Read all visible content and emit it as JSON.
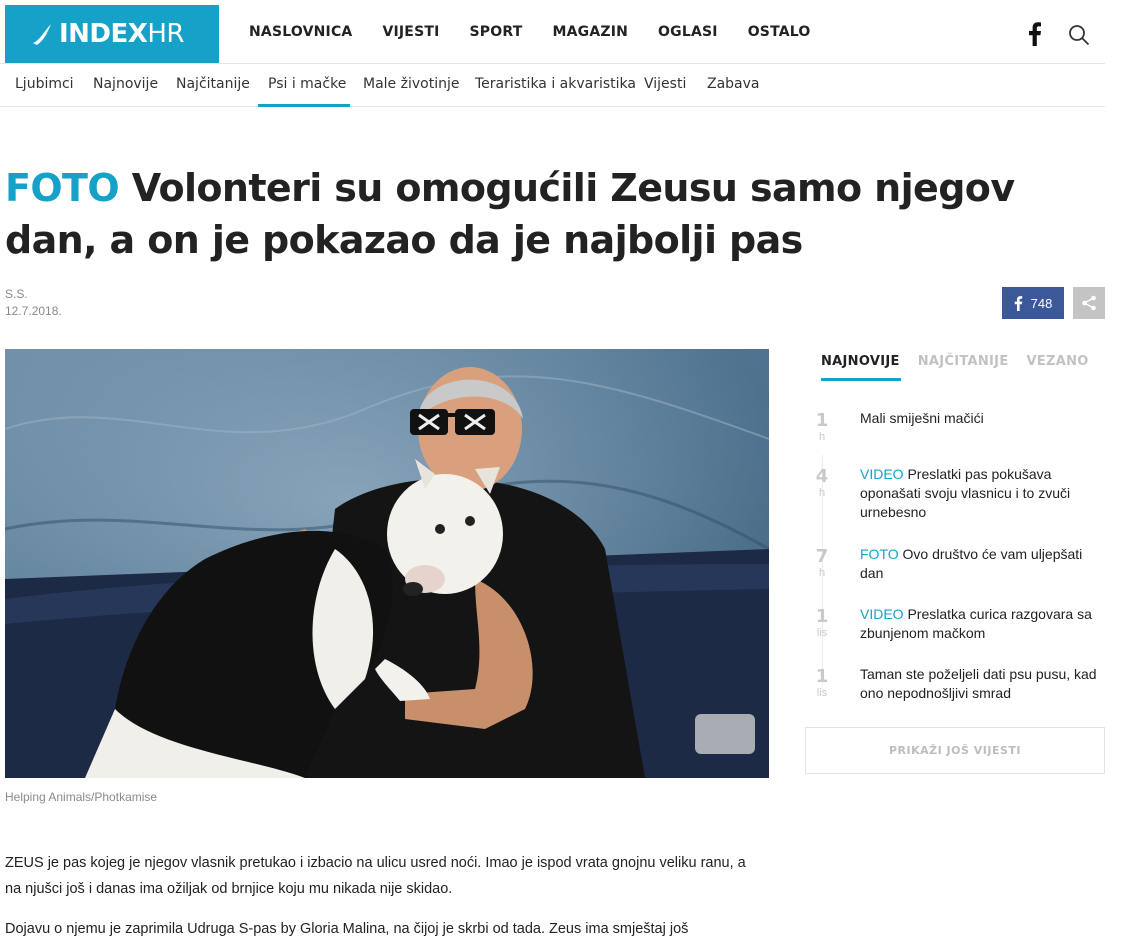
{
  "logo": {
    "brand": "INDEX",
    "suffix": "HR"
  },
  "main_nav": [
    "NASLOVNICA",
    "VIJESTI",
    "SPORT",
    "MAGAZIN",
    "OGLASI",
    "OSTALO"
  ],
  "sub_nav": {
    "items": [
      "Ljubimci",
      "Najnovije",
      "Najčitanije",
      "Psi i mačke",
      "Male životinje",
      "Teraristika i akvaristika",
      "Vijesti",
      "Zabava"
    ],
    "active": "Psi i mačke"
  },
  "article": {
    "tag": "FOTO",
    "title": "Volonteri su omogućili Zeusu samo njegov dan, a on je pokazao da je najbolji pas",
    "author": "S.S.",
    "date": "12.7.2018.",
    "share_count": "748",
    "caption": "Helping Animals/Photkamise",
    "paragraphs": [
      "ZEUS je pas kojeg je njegov vlasnik pretukao i izbacio na ulicu usred noći. Imao je ispod vrata gnojnu veliku ranu, a na njušci još i danas ima ožiljak od brnjice koju mu nikada nije skidao.",
      "Dojavu o njemu je zaprimila Udruga S-pas by Gloria Malina, na čijoj je skrbi od tada. Zeus ima smještaj još"
    ]
  },
  "sidebar": {
    "tabs": [
      "NAJNOVIJE",
      "NAJČITANIJE",
      "VEZANO"
    ],
    "active_tab": "NAJNOVIJE",
    "news": [
      {
        "time": "1",
        "unit": "h",
        "tag": "",
        "title": "Mali smiješni mačići"
      },
      {
        "time": "4",
        "unit": "h",
        "tag": "VIDEO",
        "title": "Preslatki pas pokušava oponašati svoju vlasnicu i to zvuči urnebesno"
      },
      {
        "time": "7",
        "unit": "h",
        "tag": "FOTO",
        "title": "Ovo društvo će vam uljepšati dan"
      },
      {
        "time": "1",
        "unit": "lis",
        "tag": "VIDEO",
        "title": "Preslatka curica razgovara sa zbunjenom mačkom"
      },
      {
        "time": "1",
        "unit": "lis",
        "tag": "",
        "title": "Taman ste poželjeli dati psu pusu, kad ono nepodnošljivi smrad"
      }
    ],
    "more_label": "PRIKAŽI JOŠ VIJESTI"
  },
  "colors": {
    "accent": "#16a2c8",
    "facebook": "#3b5998"
  },
  "icons": [
    "facebook-icon",
    "search-icon",
    "share-icon"
  ]
}
